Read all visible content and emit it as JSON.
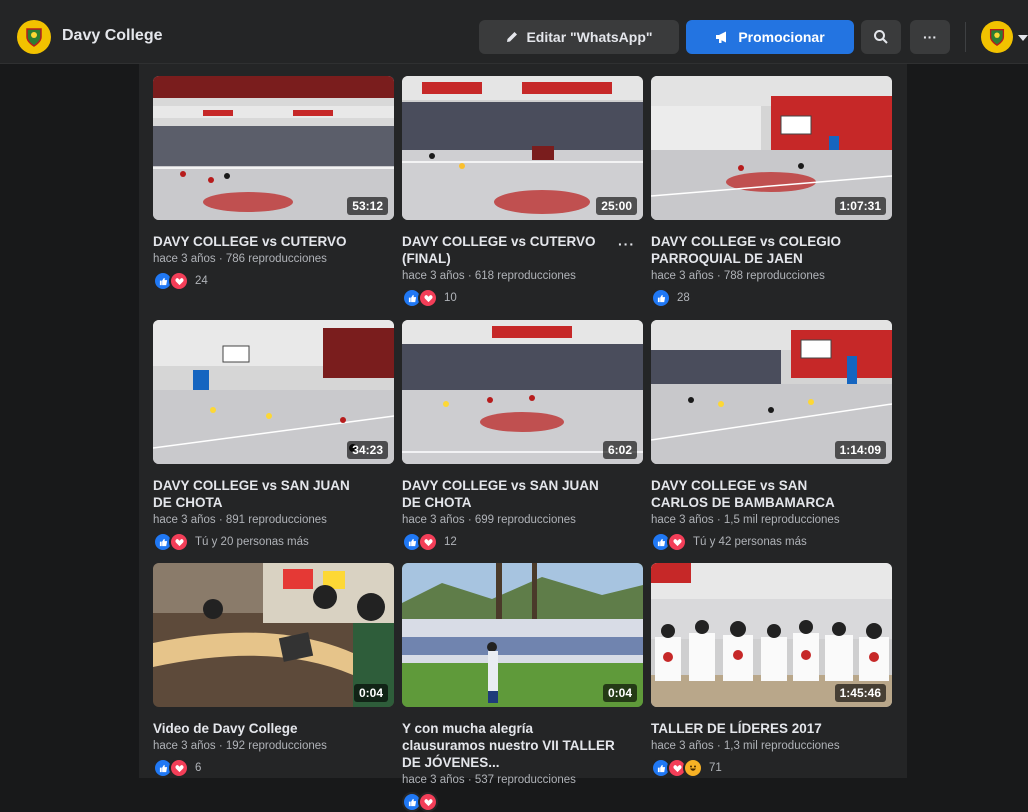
{
  "header": {
    "page_name": "Davy College",
    "edit_label": "Editar \"WhatsApp\"",
    "promote_label": "Promocionar",
    "more_label": "···"
  },
  "videos": [
    {
      "title": "DAVY COLLEGE vs CUTERVO",
      "meta": "hace 3 años · 786 reproducciones",
      "duration": "53:12",
      "reactions": [
        "like",
        "love"
      ],
      "reaction_text": "24"
    },
    {
      "title": "DAVY COLLEGE vs CUTERVO (FINAL)",
      "meta": "hace 3 años · 618 reproducciones",
      "duration": "25:00",
      "reactions": [
        "like",
        "love"
      ],
      "reaction_text": "10"
    },
    {
      "title": "DAVY COLLEGE vs COLEGIO PARROQUIAL DE JAEN",
      "meta": "hace 3 años · 788 reproducciones",
      "duration": "1:07:31",
      "reactions": [
        "like"
      ],
      "reaction_text": "28"
    },
    {
      "title": "DAVY COLLEGE vs SAN JUAN DE CHOTA",
      "meta": "hace 3 años · 891 reproducciones",
      "duration": "34:23",
      "reactions": [
        "like",
        "love"
      ],
      "reaction_text": "Tú y 20 personas más"
    },
    {
      "title": "DAVY COLLEGE vs SAN JUAN DE CHOTA",
      "meta": "hace 3 años · 699 reproducciones",
      "duration": "6:02",
      "reactions": [
        "like",
        "love"
      ],
      "reaction_text": "12"
    },
    {
      "title": "DAVY COLLEGE vs SAN CARLOS DE BAMBAMARCA",
      "meta": "hace 3 años · 1,5 mil reproducciones",
      "duration": "1:14:09",
      "reactions": [
        "like",
        "love"
      ],
      "reaction_text": "Tú y 42 personas más"
    },
    {
      "title": "Video de Davy College",
      "meta": "hace 3 años · 192 reproducciones",
      "duration": "0:04",
      "reactions": [
        "like",
        "love"
      ],
      "reaction_text": "6"
    },
    {
      "title": "Y con mucha alegría clausuramos nuestro VII TALLER DE JÓVENES...",
      "meta": "hace 3 años · 537 reproducciones",
      "duration": "0:04",
      "reactions": [
        "like",
        "love"
      ],
      "reaction_text": ""
    },
    {
      "title": "TALLER DE LÍDERES 2017",
      "meta": "hace 3 años · 1,3 mil reproducciones",
      "duration": "1:45:46",
      "reactions": [
        "like",
        "love",
        "haha"
      ],
      "reaction_text": "71"
    }
  ],
  "colors": {
    "background": "#18191a",
    "surface": "#242526",
    "accent": "#2374e1",
    "like": "#2078f4",
    "love": "#f33e58"
  }
}
